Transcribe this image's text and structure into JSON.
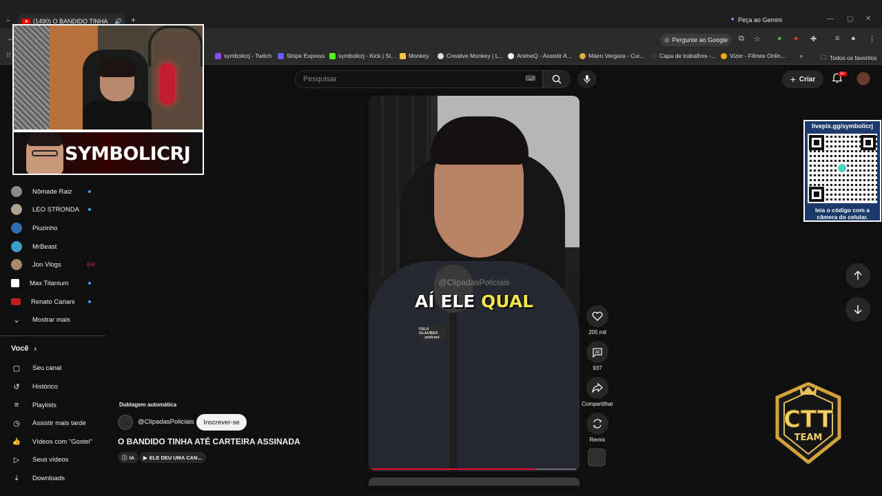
{
  "browser": {
    "tab_title": "(1490) O BANDIDO TINHA",
    "gemini_label": "Peça ao Gemini",
    "ask_google_label": "Pergunte ao Google"
  },
  "bookmarks": [
    {
      "label": "symbolicrj - Twitch",
      "color": "#9146ff"
    },
    {
      "label": "Stripe Express",
      "color": "#635bff"
    },
    {
      "label": "symbolicrj - Kick | St...",
      "color": "#53fc18"
    },
    {
      "label": "Monkey",
      "color": "#f5c542"
    },
    {
      "label": "Creative Monkey | L...",
      "color": "#dddddd"
    },
    {
      "label": "AnimeQ - Assistir A...",
      "color": "#ffffff"
    },
    {
      "label": "Mairo Vergara - Cur...",
      "color": "#e0b43a"
    },
    {
      "label": "Capa de trabalhos -...",
      "color": "#333333"
    },
    {
      "label": "Vizer - Filmes Onlin...",
      "color": "#f2a900"
    },
    {
      "label": "Todos os favoritos",
      "color": "#888888"
    }
  ],
  "youtube": {
    "search_placeholder": "Pesquisar",
    "create_label": "Criar",
    "notifications_badge": "9+"
  },
  "sidebar": {
    "subscriptions": [
      {
        "label": "Nômade Raiz",
        "color": "#8a8a8a",
        "status": "dot"
      },
      {
        "label": "LEO STRONDA",
        "color": "#b0a090",
        "status": "dot"
      },
      {
        "label": "Piuzinho",
        "color": "#2f6db5",
        "status": ""
      },
      {
        "label": "MrBeast",
        "color": "#3aa0c9",
        "status": ""
      },
      {
        "label": "Jon Vlogs",
        "color": "#a88a6a",
        "status": "live"
      },
      {
        "label": "Max Titanium",
        "color": "#ffffff",
        "status": "dot"
      },
      {
        "label": "Renato Cariani",
        "color": "#c21f1f",
        "status": "dot"
      }
    ],
    "show_more": "Mostrar mais",
    "voce_label": "Você",
    "you_items": [
      {
        "label": "Seu canal",
        "icon": "channel-icon",
        "glyph": "▢"
      },
      {
        "label": "Histórico",
        "icon": "history-icon",
        "glyph": "↺"
      },
      {
        "label": "Playlists",
        "icon": "playlist-icon",
        "glyph": "≡"
      },
      {
        "label": "Assistir mais tarde",
        "icon": "clock-icon",
        "glyph": "◷"
      },
      {
        "label": "Vídeos com \"Gostei\"",
        "icon": "thumbs-up-icon",
        "glyph": "👍"
      },
      {
        "label": "Seus vídeos",
        "icon": "video-icon",
        "glyph": "▷"
      },
      {
        "label": "Downloads",
        "icon": "download-icon",
        "glyph": "⤓"
      }
    ]
  },
  "overlay": {
    "streamer_name": "SYMBOLICRJ",
    "qr_url": "livepix.gg/symbolicrj",
    "qr_caption_line1": "leia o código com a",
    "qr_caption_line2": "câmera do celular.",
    "badge_text": "CTT",
    "badge_subtext": "TEAM"
  },
  "video": {
    "watermark": "@ClipadasPoliciais",
    "caption_white": "AÍ ELE",
    "caption_yellow": "QUAL",
    "podcast_name_1": "FALA GLAUBER",
    "podcast_name_2": "podcast",
    "progress_fraction": 0.8,
    "dub_label": "Dublagem automática",
    "channel": "@ClipadasPoliciais",
    "subscribe_label": "Inscrever-se",
    "title": "O BANDIDO TINHA ATÉ CARTEIRA ASSINADA",
    "chip_ai": "IA",
    "chip_music": "ELE DEU UMA CAN..."
  },
  "actions": {
    "likes": "205 mil",
    "comments": "937",
    "share": "Compartilhar",
    "remix": "Remix"
  }
}
